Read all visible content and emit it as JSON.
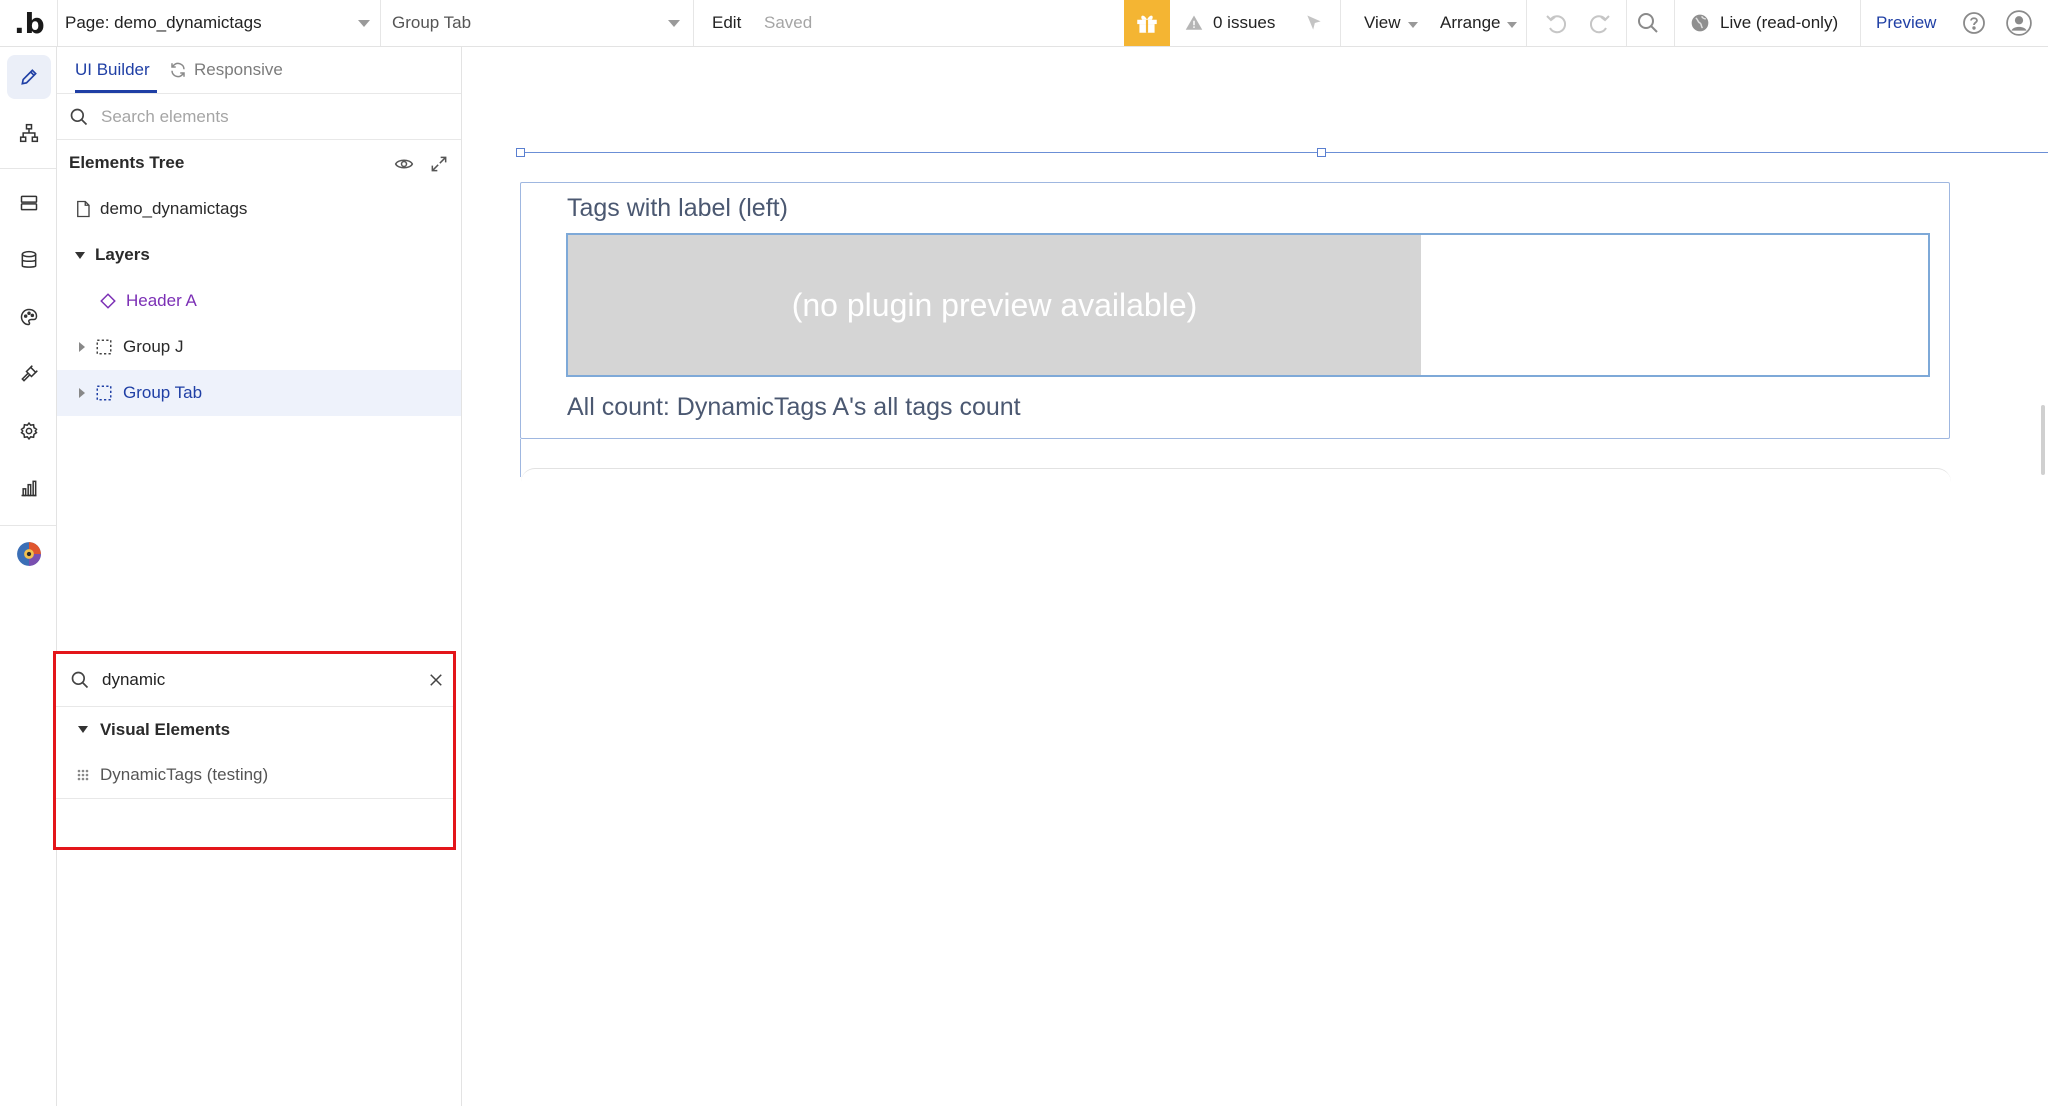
{
  "topbar": {
    "logo": ".b",
    "page_select": "Page: demo_dynamictags",
    "group_select": "Group Tab",
    "edit": "Edit",
    "saved": "Saved",
    "issues": "0 issues",
    "view": "View",
    "arrange": "Arrange",
    "live": "Live (read-only)",
    "preview": "Preview",
    "accent_color": "#f4b533"
  },
  "rail": {
    "icons": [
      "pencil-icon",
      "workflow-icon",
      "data-icon",
      "database-icon",
      "palette-icon",
      "plugin-icon",
      "settings-icon",
      "chart-icon",
      "profile-color-icon"
    ]
  },
  "panel": {
    "tabs": {
      "ui_builder": "UI Builder",
      "responsive": "Responsive"
    },
    "search_placeholder": "Search elements",
    "tree_title": "Elements Tree",
    "page_node": "demo_dynamictags",
    "layers_label": "Layers",
    "items": [
      {
        "label": "Header A",
        "type": "reusable"
      },
      {
        "label": "Group J",
        "type": "group"
      },
      {
        "label": "Group Tab",
        "type": "group",
        "selected": true
      }
    ]
  },
  "element_search": {
    "query": "dynamic",
    "category": "Visual Elements",
    "results": [
      "DynamicTags (testing)"
    ],
    "highlight_color": "#e3151a"
  },
  "canvas": {
    "label_left": "Tags with label (left)",
    "plugin_preview": "(no plugin preview available)",
    "all_count": "All count: DynamicTags A's all tags count"
  }
}
